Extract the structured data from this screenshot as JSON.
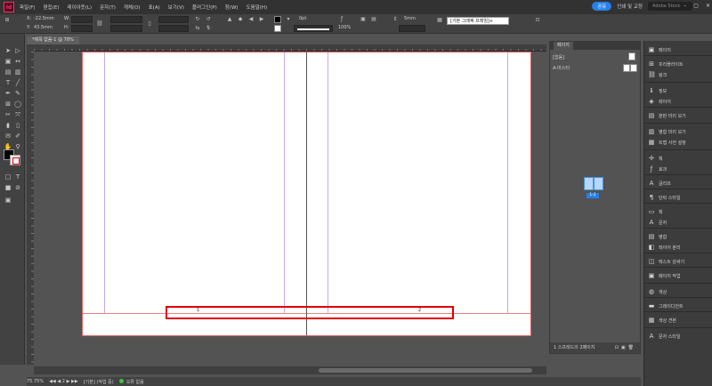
{
  "app": {
    "logo": "Id",
    "menu": [
      "파일(F)",
      "편집(E)",
      "레이아웃(L)",
      "문자(T)",
      "개체(O)",
      "표(A)",
      "보기(V)",
      "플러그인(P)",
      "창(W)",
      "도움말(H)"
    ],
    "share_label": "공유",
    "workspace_label": "인쇄 및 교정",
    "stock_placeholder": "Adobe Stock",
    "window_controls": [
      "–",
      "▢",
      "✕"
    ]
  },
  "controlbar": {
    "x_label": "X:",
    "x_value": "-22.5mm",
    "y_label": "Y:",
    "y_value": "43.5mm",
    "w_label": "W:",
    "h_label": "H:",
    "stroke_weight": "0pt",
    "scale": "100%",
    "offset": "5mm",
    "object_style": "[기본 그래픽 프레임]+"
  },
  "document": {
    "tab_label": "*제목 없음-1 @ 78%",
    "page_numbers": [
      "1",
      "2"
    ]
  },
  "pages_panel": {
    "tab_label": "페이지",
    "master_none": "[없음]",
    "master_a": "A-마스터",
    "spread_label": "1-2",
    "footer_text": "1 스프레드의 2페이지"
  },
  "dock": {
    "items": [
      {
        "icon": "▣",
        "label": "페이지"
      },
      {
        "icon": "⊞",
        "label": "프리플라이트"
      },
      {
        "icon": "⛓",
        "label": "링크"
      },
      {
        "icon": "ℹ",
        "label": "정보"
      },
      {
        "icon": "◈",
        "label": "레이어"
      },
      {
        "icon": "▤",
        "label": "분판 미리 보기"
      },
      {
        "icon": "▥",
        "label": "병합 미리 보기"
      },
      {
        "icon": "▦",
        "label": "트랩 사전 설정"
      },
      {
        "icon": "✢",
        "label": "획"
      },
      {
        "icon": "ƒ",
        "label": "효과"
      },
      {
        "icon": "A",
        "label": "글리프"
      },
      {
        "icon": "¶",
        "label": "단락 스타일"
      },
      {
        "icon": "▭",
        "label": "획"
      },
      {
        "icon": "A",
        "label": "문자"
      },
      {
        "icon": "▤",
        "label": "병합"
      },
      {
        "icon": "◧",
        "label": "레이어 분리"
      },
      {
        "icon": "◫",
        "label": "텍스트 감싸기"
      },
      {
        "icon": "▣",
        "label": "페이지 작업"
      },
      {
        "icon": "◍",
        "label": "색상"
      },
      {
        "icon": "▬",
        "label": "그레이디언트"
      },
      {
        "icon": "▦",
        "label": "색상 견본"
      },
      {
        "icon": "A",
        "label": "문자 스타일"
      }
    ]
  },
  "status": {
    "zoom": "75.75%",
    "page_nav": "◀◀ ◀ 2 ▶ ▶▶",
    "style_info": "[기본] (작업 중)",
    "preflight": "오류 없음"
  },
  "colors": {
    "accent": "#2680eb",
    "highlight": "#e00000",
    "bleed": "#e35a5a",
    "margin": "#c9a8e8"
  }
}
